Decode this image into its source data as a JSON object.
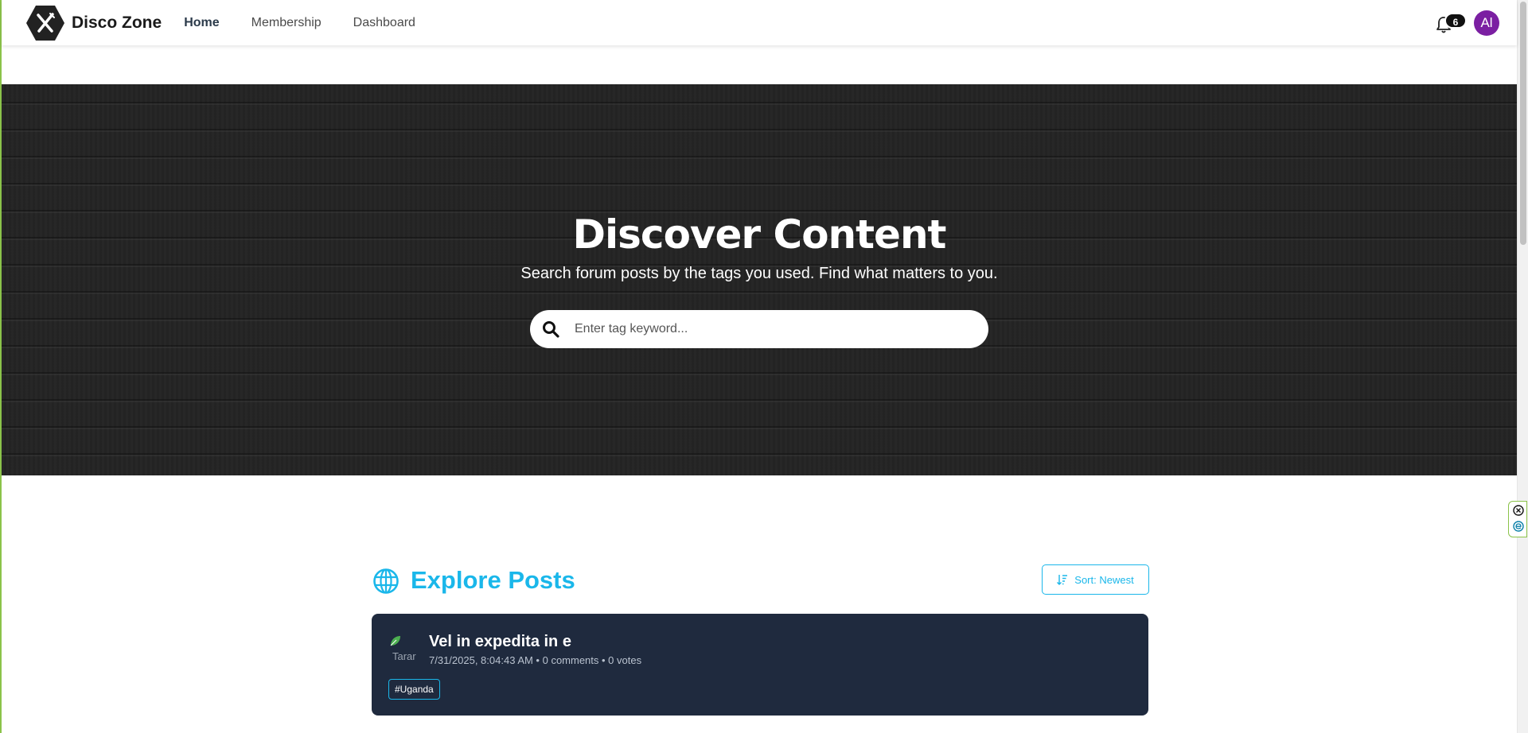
{
  "navbar": {
    "brand": "Disco Zone",
    "links": [
      {
        "label": "Home",
        "active": true
      },
      {
        "label": "Membership",
        "active": false
      },
      {
        "label": "Dashboard",
        "active": false
      }
    ],
    "notification_count": "6",
    "avatar_initials": "Al",
    "avatar_color": "#7b1fa2"
  },
  "hero": {
    "title": "Discover Content",
    "subtitle": "Search forum posts by the tags you used. Find what matters to you.",
    "search_placeholder": "Enter tag keyword..."
  },
  "explore": {
    "title": "Explore Posts",
    "sort_label": "Sort: Newest",
    "accent_color": "#1ab7ea"
  },
  "posts": [
    {
      "title": "Vel in expedita in e",
      "meta": "7/31/2025, 8:04:43 AM • 0 comments • 0 votes",
      "avatar_alt": "Tarar",
      "tag": "#Uganda"
    }
  ]
}
